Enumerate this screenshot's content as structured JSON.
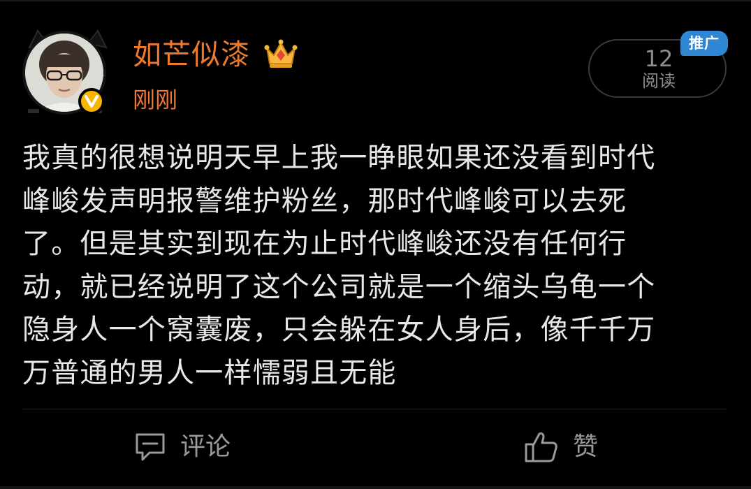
{
  "post": {
    "author": {
      "name": "如芒似漆",
      "verified_badge_icon": "vip-v-icon",
      "membership_icon": "crown-icon"
    },
    "time": "刚刚",
    "read_counter": {
      "count": "12",
      "label": "阅读"
    },
    "promo_tag": "推广",
    "body_lines": [
      "我真的很想说明天早上我一睁眼如果还没看到时代",
      "峰峻发声明报警维护粉丝，那时代峰峻可以去死",
      "了。但是其实到现在为止时代峰峻还没有任何行",
      "动，就已经说明了这个公司就是一个缩头乌龟一个",
      "隐身人一个窝囊废，只会躲在女人身后，像千千万",
      "万普通的男人一样懦弱且无能"
    ],
    "actions": {
      "comment_label": "评论",
      "comment_icon": "comment-icon",
      "like_label": "赞",
      "like_icon": "thumbs-up-icon"
    }
  },
  "colors": {
    "background": "#000000",
    "author_accent": "#ee7a2f",
    "promo_blue": "#2f86d3",
    "vip_yellow": "#f7b500",
    "body_text": "#e8e8e8",
    "muted_text": "#9a9a9a"
  }
}
